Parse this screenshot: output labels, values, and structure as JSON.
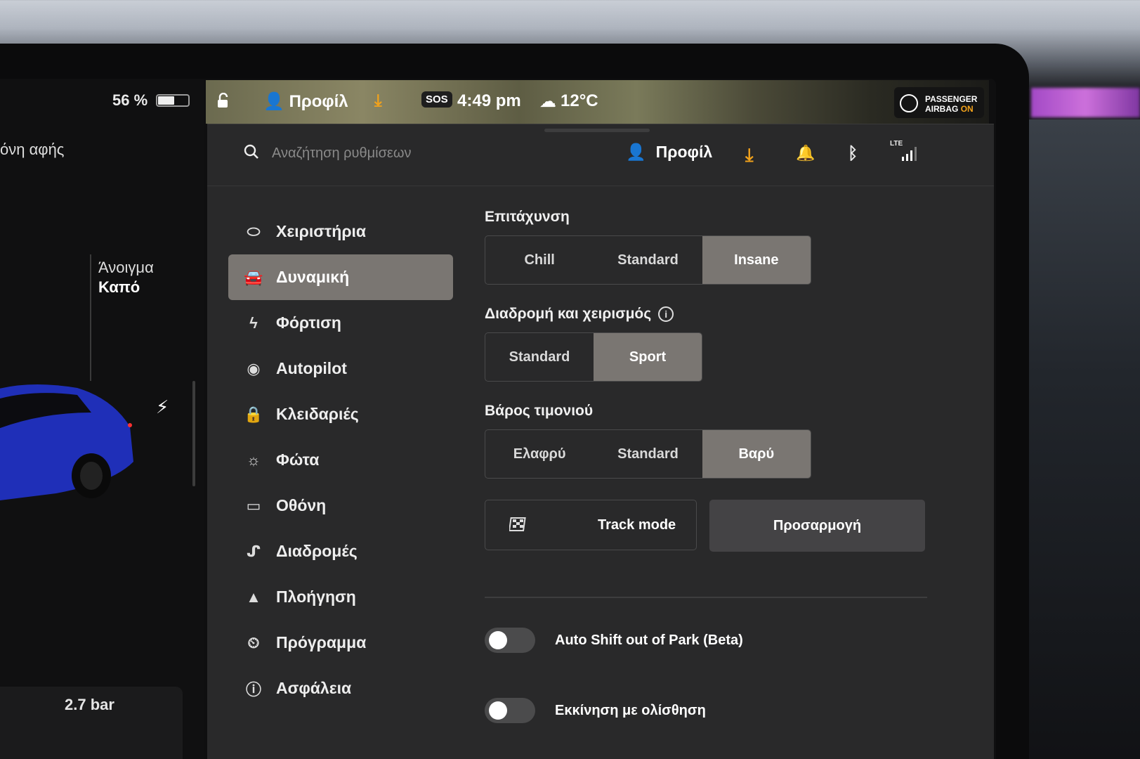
{
  "left": {
    "battery": "56 %",
    "touch_label": "όνη αφής",
    "trunk_label": "Άνοιγμα",
    "trunk_value": "Καπό",
    "tire_pressure": "2.7 bar"
  },
  "status_bar": {
    "profile": "Προφίλ",
    "sos": "SOS",
    "time": "4:49 pm",
    "temperature": "12°C",
    "airbag_line1": "PASSENGER",
    "airbag_line2a": "AIRBAG",
    "airbag_line2b": "ON",
    "accent_color": "#f2a21b"
  },
  "header": {
    "search_placeholder": "Αναζήτηση ρυθμίσεων",
    "profile": "Προφίλ",
    "lte": "LTE"
  },
  "nav": {
    "items": [
      {
        "label": "Χειριστήρια",
        "icon": "toggle-icon"
      },
      {
        "label": "Δυναμική",
        "icon": "car-icon",
        "active": true
      },
      {
        "label": "Φόρτιση",
        "icon": "bolt-icon"
      },
      {
        "label": "Autopilot",
        "icon": "steering-wheel-icon"
      },
      {
        "label": "Κλειδαριές",
        "icon": "lock-icon"
      },
      {
        "label": "Φώτα",
        "icon": "sun-icon"
      },
      {
        "label": "Οθόνη",
        "icon": "display-icon"
      },
      {
        "label": "Διαδρομές",
        "icon": "trips-icon"
      },
      {
        "label": "Πλοήγηση",
        "icon": "navigation-icon"
      },
      {
        "label": "Πρόγραμμα",
        "icon": "clock-icon"
      },
      {
        "label": "Ασφάλεια",
        "icon": "alert-icon"
      }
    ]
  },
  "content": {
    "acceleration": {
      "title": "Επιτάχυνση",
      "options": [
        "Chill",
        "Standard",
        "Insane"
      ],
      "selected": "Insane"
    },
    "ride_handling": {
      "title": "Διαδρομή και χειρισμός",
      "options": [
        "Standard",
        "Sport"
      ],
      "selected": "Sport"
    },
    "steering": {
      "title": "Βάρος τιμονιού",
      "options": [
        "Ελαφρύ",
        "Standard",
        "Βαρύ"
      ],
      "selected": "Βαρύ"
    },
    "track_mode": "Track mode",
    "customize": "Προσαρμογή",
    "toggles": [
      {
        "label": "Auto Shift out of Park (Beta)",
        "on": false
      },
      {
        "label": "Εκκίνηση με ολίσθηση",
        "on": false
      }
    ]
  }
}
